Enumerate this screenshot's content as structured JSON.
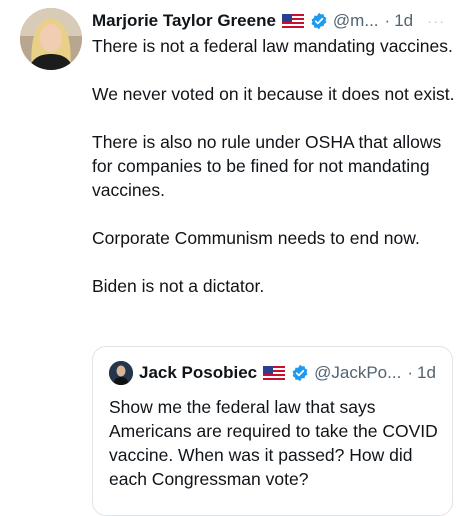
{
  "tweet": {
    "author_name": "Marjorie Taylor Greene",
    "handle": "@m...",
    "separator": "·",
    "time": "1d",
    "more": "···",
    "paragraphs": [
      "There is not a federal law mandating vaccines.",
      "We never voted on it because it does not exist.",
      "There is also no rule under OSHA that allows for companies to be fined for not mandating vaccines.",
      "Corporate Communism needs to end now.",
      "Biden is not a dictator."
    ],
    "flag_icon": "us-flag-icon",
    "verified_icon": "verified-badge-icon"
  },
  "quoted_tweet": {
    "author_name": "Jack Posobiec",
    "handle": "@JackPo...",
    "separator": "·",
    "time": "1d",
    "text": "Show me the federal law that says Americans are required to take the COVID vaccine. When was it passed? How did each Congressman vote?"
  },
  "colors": {
    "verified_blue": "#1d9bf0",
    "secondary_text": "#536471",
    "primary_text": "#0f1419",
    "quote_border": "#dfe4e8"
  }
}
